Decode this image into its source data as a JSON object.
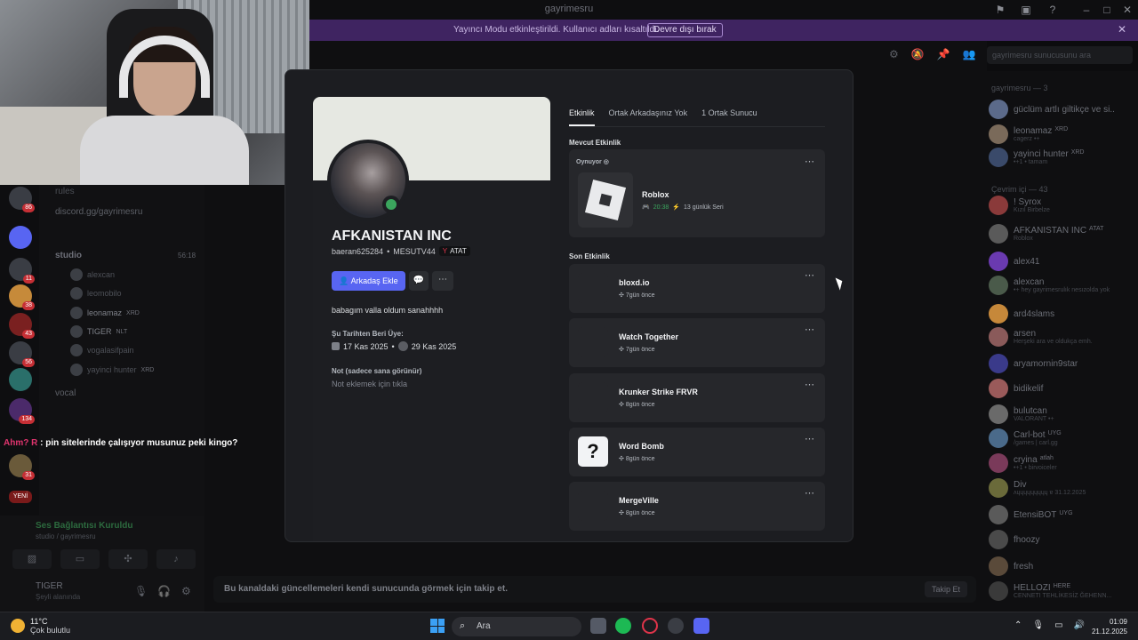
{
  "window": {
    "title": "gayrimesru",
    "streamer_mode_msg": "Yayıncı Modu etkinleştirildi. Kullanıcı adları kısaltıldı.",
    "disable_button": "Devre dışı bırak"
  },
  "left_sidebar": {
    "server_badges": [
      "86",
      "11",
      "38",
      "43",
      "56",
      "134",
      "31",
      "YENİ"
    ],
    "channels": [
      "rules",
      "discord.gg/gayrimesru"
    ],
    "voice_channel": "studio",
    "voice_timer": "56:18",
    "voice_users": [
      {
        "name": "alexcan",
        "tag": ""
      },
      {
        "name": "leomobilo",
        "tag": ""
      },
      {
        "name": "leonamaz",
        "tag": "XRD"
      },
      {
        "name": "TIGER",
        "tag": "NLT"
      },
      {
        "name": "vogalasifpain",
        "tag": ""
      },
      {
        "name": "yayinci hunter",
        "tag": "XRD"
      }
    ],
    "other_channel": "vocal",
    "chat_overlay_user": "Ahm? R",
    "chat_overlay_text": ": pin sitelerinde çalışıyor musunuz peki kingo?",
    "voice_status": "Ses Bağlantısı Kuruldu",
    "voice_sub": "studio / gayrimesru",
    "me_name": "TIGER",
    "me_status": "Şeyli alanında"
  },
  "header": {
    "search_placeholder": "gayrimesru sunucusunu ara"
  },
  "follow_bar": {
    "text": "Bu kanaldaki güncellemeleri kendi sunucunda görmek için takip et.",
    "button": "Takip Et"
  },
  "members": {
    "group1": "gayrimesru — 3",
    "group2": "Çevrim içi — 43",
    "list": [
      {
        "name": "güclüm artlı giltikçe ve si..",
        "sub": "",
        "tag": ""
      },
      {
        "name": "leonamaz",
        "sub": "cagerz •+",
        "tag": "XRD"
      },
      {
        "name": "yayinci hunter",
        "sub": "•+1 • tamam",
        "tag": "XRD"
      },
      {
        "name": "! Syrox",
        "sub": "Kızıl Birbelze",
        "tag": ""
      },
      {
        "name": "AFKANISTAN INC",
        "sub": "Roblox",
        "tag": "ATAT"
      },
      {
        "name": "alex41",
        "sub": "",
        "tag": ""
      },
      {
        "name": "alexcan",
        "sub": "•+ hey gayrimesrulık nesızolda yok",
        "tag": ""
      },
      {
        "name": "ard4slams",
        "sub": "",
        "tag": ""
      },
      {
        "name": "arsen",
        "sub": "Herşeki ara ve oldukça emh.",
        "tag": ""
      },
      {
        "name": "aryamornin9star",
        "sub": "",
        "tag": ""
      },
      {
        "name": "bidikelif",
        "sub": "",
        "tag": ""
      },
      {
        "name": "bulutcan",
        "sub": "VALORANT •+",
        "tag": ""
      },
      {
        "name": "Carl-bot",
        "sub": "/games | carl.gg",
        "tag": "UYG"
      },
      {
        "name": "cryina",
        "sub": "•+1 • birvoiceler",
        "tag": "atlah"
      },
      {
        "name": "Div",
        "sub": "ʌɥɥɥɥɥɥɥɥɥ ɐ 31.12.2025",
        "tag": ""
      },
      {
        "name": "EtensiBOT",
        "sub": "",
        "tag": "UYG"
      },
      {
        "name": "fhoozy",
        "sub": "",
        "tag": ""
      },
      {
        "name": "fresh",
        "sub": "",
        "tag": ""
      },
      {
        "name": "HELLOZI",
        "sub": "CENNETI TEHLİKESİZ ĞEHENN...",
        "tag": "HERE"
      }
    ]
  },
  "profile": {
    "display_name": "AFKANISTAN INC",
    "username": "baeran625284",
    "server_name": "MESUTV44",
    "tag": "ATAT",
    "add_friend": "Arkadaş Ekle",
    "bio": "babagım valla oldum sanahhhh",
    "member_since_label": "Şu Tarihten Beri Üye:",
    "discord_since": "17 Kas 2025",
    "server_since": "29 Kas 2025",
    "note_label": "Not (sadece sana görünür)",
    "note_placeholder": "Not eklemek için tıkla",
    "tabs": [
      "Etkinlik",
      "Ortak Arkadaşınız Yok",
      "1 Ortak Sunucu"
    ],
    "current_activity_label": "Mevcut Etkinlik",
    "playing_label": "Oynuyor",
    "current_game": "Roblox",
    "current_time": "20:38",
    "current_streak": "13 günlük Seri",
    "recent_label": "Son Etkinlik",
    "recent": [
      {
        "name": "bloxd.io",
        "when": "7gün önce"
      },
      {
        "name": "Watch Together",
        "when": "7gün önce"
      },
      {
        "name": "Krunker Strike FRVR",
        "when": "8gün önce"
      },
      {
        "name": "Word Bomb",
        "when": "8gün önce"
      },
      {
        "name": "MergeVille",
        "when": "8gün önce"
      }
    ]
  },
  "taskbar": {
    "temp": "11°C",
    "weather": "Çok bulutlu",
    "search": "Ara",
    "time": "01:09",
    "date": "21.12.2025"
  }
}
